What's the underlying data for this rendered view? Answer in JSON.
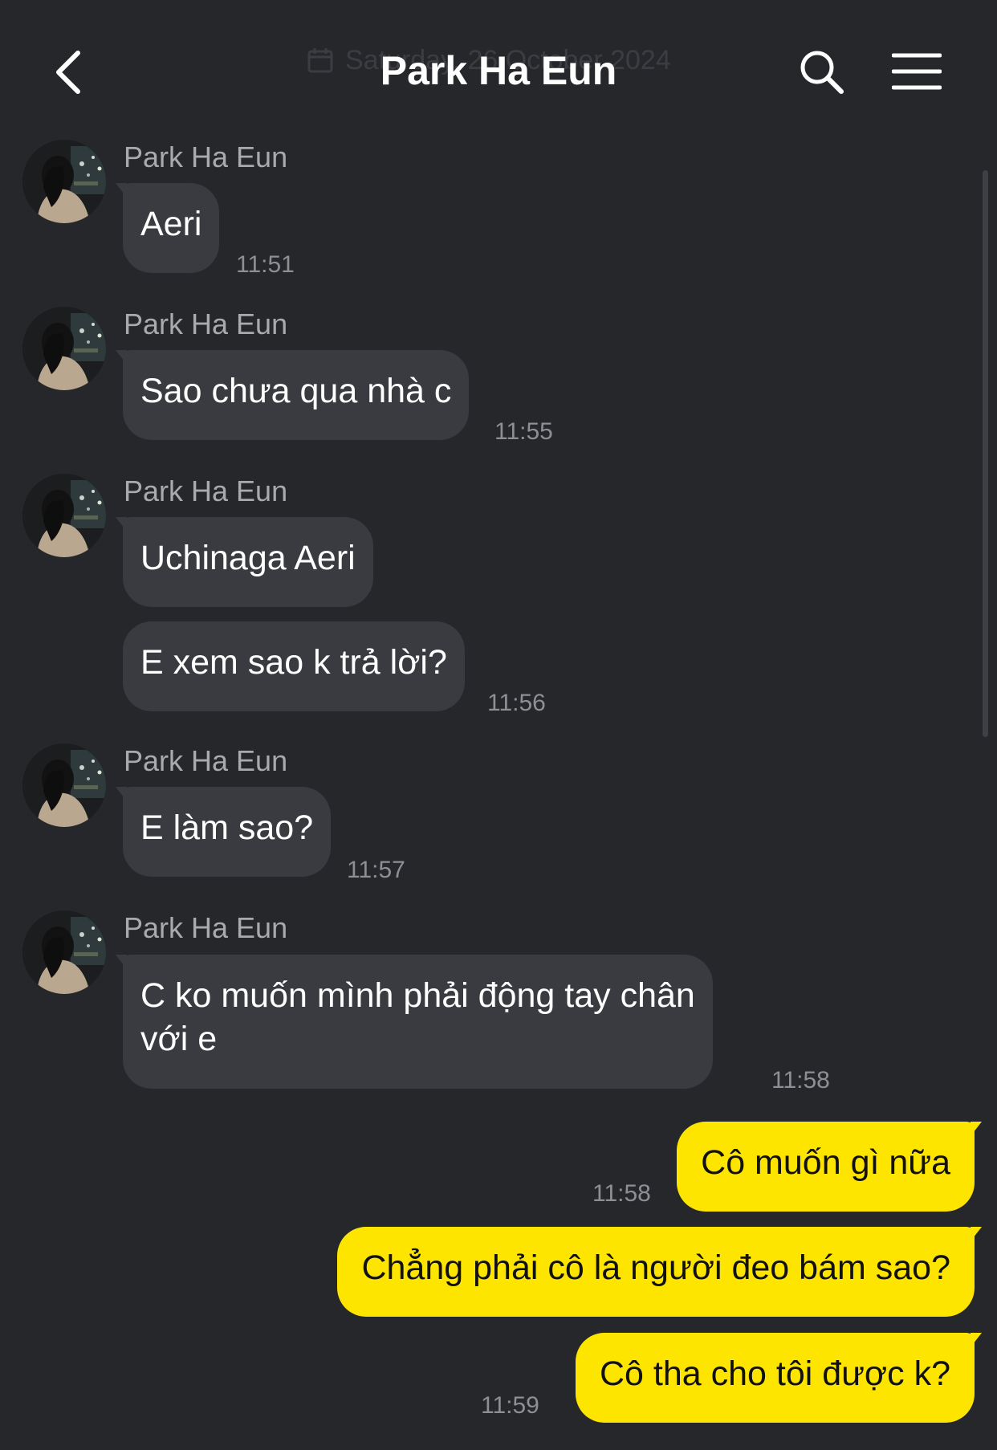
{
  "header": {
    "title": "Park Ha Eun",
    "date_banner": "Saturday, 26 October 2024",
    "back_icon": "chevron-left-icon",
    "search_icon": "search-icon",
    "menu_icon": "hamburger-menu-icon"
  },
  "colors": {
    "background": "#26272b",
    "incoming_bubble": "#3a3b40",
    "outgoing_bubble": "#fee500",
    "sender_name": "#a9aaae",
    "timestamp": "#8e8f94"
  },
  "messages": {
    "g1": {
      "sender": "Park Ha Eun",
      "text": "Aeri",
      "time": "11:51"
    },
    "g2": {
      "sender": "Park Ha Eun",
      "text": "Sao chưa qua nhà c",
      "time": "11:55"
    },
    "g3": {
      "sender": "Park Ha Eun",
      "text1": "Uchinaga Aeri",
      "text2": "E xem sao k trả lời?",
      "time": "11:56"
    },
    "g4": {
      "sender": "Park Ha Eun",
      "text": "E làm sao?",
      "time": "11:57"
    },
    "g5": {
      "sender": "Park Ha Eun",
      "line1": "C ko muốn mình phải động tay chân",
      "line2": "với e",
      "time": "11:58"
    },
    "out1": {
      "text": "Cô muốn gì nữa",
      "time": "11:58"
    },
    "out2": {
      "text": "Chẳng phải cô là người đeo bám sao?"
    },
    "out3": {
      "text": "Cô tha cho tôi được k?",
      "time": "11:59"
    }
  }
}
